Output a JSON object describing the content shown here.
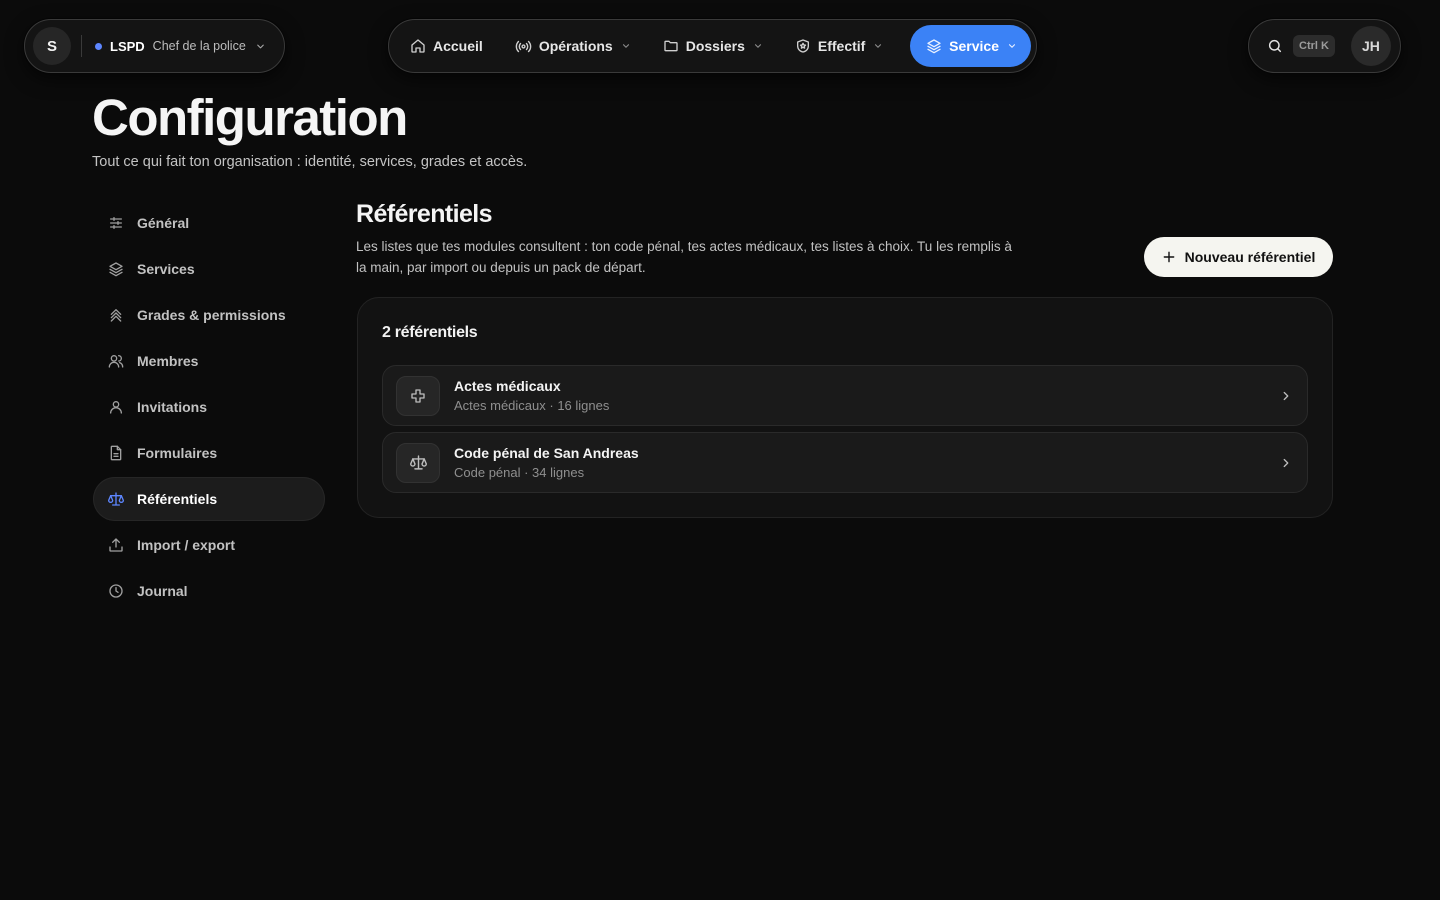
{
  "org": {
    "avatar_letter": "S",
    "name": "LSPD",
    "role": "Chef de la police",
    "status_color": "#5d86ff"
  },
  "nav": {
    "items": [
      {
        "label": "Accueil",
        "icon": "home-icon",
        "has_menu": false
      },
      {
        "label": "Opérations",
        "icon": "broadcast-icon",
        "has_menu": true
      },
      {
        "label": "Dossiers",
        "icon": "folder-icon",
        "has_menu": true
      },
      {
        "label": "Effectif",
        "icon": "shield-icon",
        "has_menu": true
      },
      {
        "label": "Service",
        "icon": "layers-icon",
        "has_menu": true,
        "active": true
      }
    ],
    "active_color": "#3b82f6"
  },
  "search": {
    "shortcut": "Ctrl K"
  },
  "user": {
    "initials": "JH"
  },
  "page": {
    "title": "Configuration",
    "subtitle": "Tout ce qui fait ton organisation : identité, services, grades et accès."
  },
  "sidebar": {
    "items": [
      {
        "label": "Général",
        "icon": "sliders-icon"
      },
      {
        "label": "Services",
        "icon": "layers-icon"
      },
      {
        "label": "Grades & permissions",
        "icon": "chevrons-up-icon"
      },
      {
        "label": "Membres",
        "icon": "users-icon"
      },
      {
        "label": "Invitations",
        "icon": "user-icon"
      },
      {
        "label": "Formulaires",
        "icon": "file-icon"
      },
      {
        "label": "Référentiels",
        "icon": "scale-icon",
        "active": true
      },
      {
        "label": "Import / export",
        "icon": "upload-icon"
      },
      {
        "label": "Journal",
        "icon": "clock-icon"
      }
    ]
  },
  "section": {
    "title": "Référentiels",
    "description": "Les listes que tes modules consultent : ton code pénal, tes actes médicaux, tes listes à choix. Tu les remplis à la main, par import ou depuis un pack de départ.",
    "new_button": "Nouveau référentiel",
    "count_label": "2 référentiels",
    "items": [
      {
        "title": "Actes médicaux",
        "meta": "Actes médicaux · 16 lignes",
        "icon": "medical-cross-icon"
      },
      {
        "title": "Code pénal de San Andreas",
        "meta": "Code pénal · 34 lignes",
        "icon": "scale-icon"
      }
    ]
  }
}
